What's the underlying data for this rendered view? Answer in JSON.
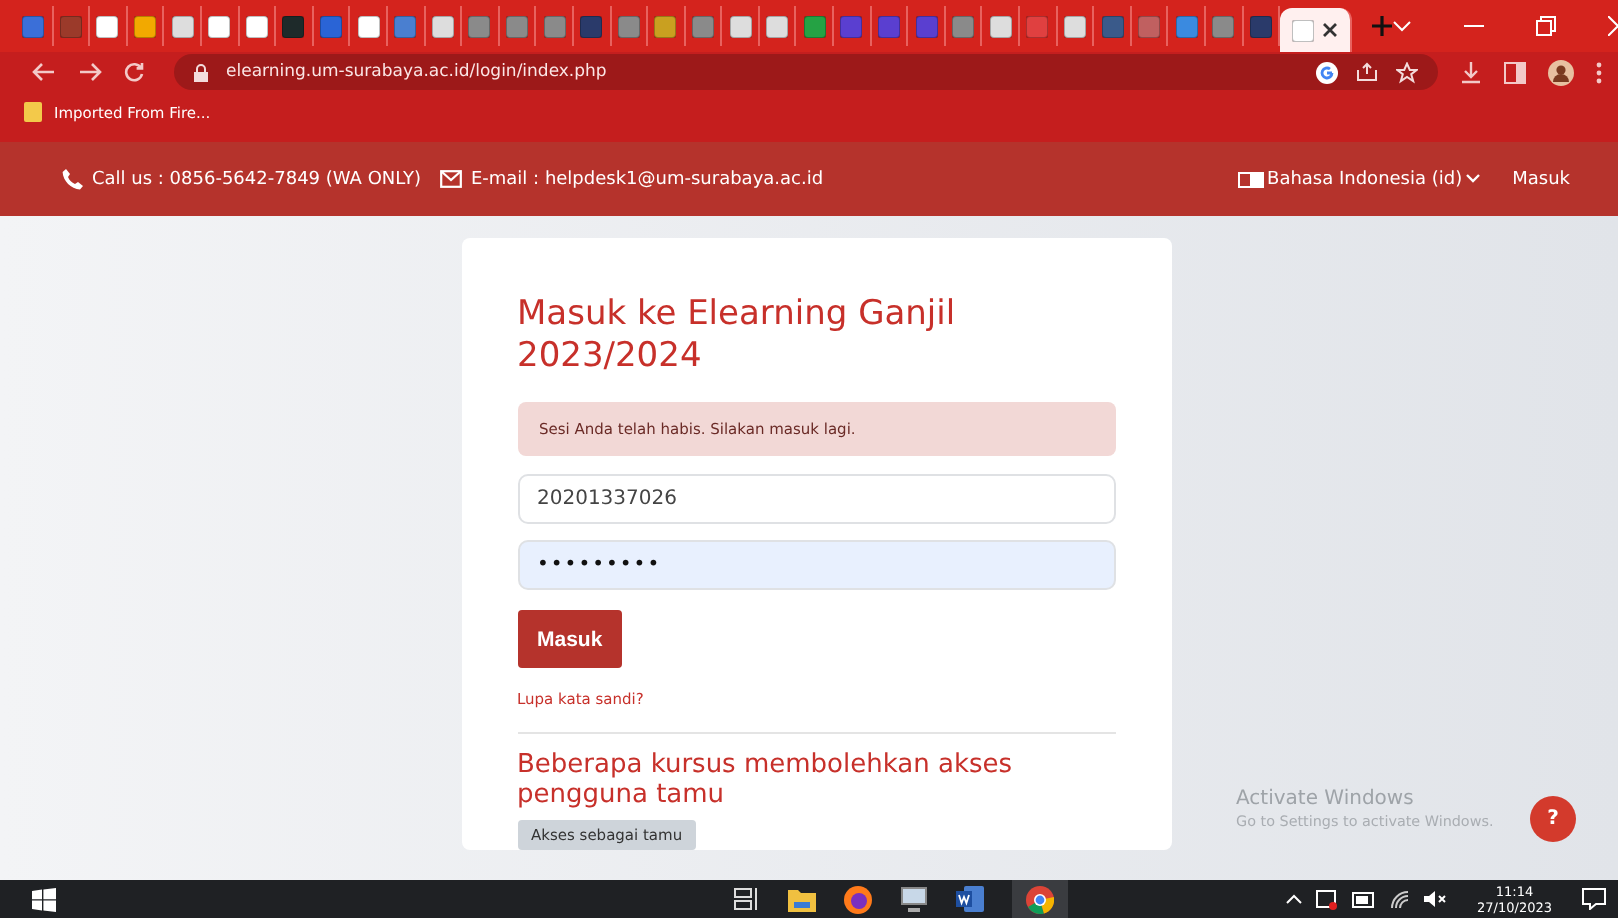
{
  "browser": {
    "tabs": [
      {
        "color": "#3b6fd8",
        "selected": false
      },
      {
        "color": "#9b3a2a",
        "selected": false
      },
      {
        "color": "#ffffff",
        "selected": false
      },
      {
        "color": "#f2a900",
        "selected": false
      },
      {
        "color": "#dddddd",
        "selected": false
      },
      {
        "color": "#ffffff",
        "selected": false
      },
      {
        "color": "#ffffff",
        "selected": false
      },
      {
        "color": "#1e2a2a",
        "selected": false
      },
      {
        "color": "#2a64d6",
        "selected": false
      },
      {
        "color": "#ffffff",
        "selected": false
      },
      {
        "color": "#4a7fd0",
        "selected": false
      },
      {
        "color": "#dddddd",
        "selected": false
      },
      {
        "color": "#8a8a8a",
        "selected": false
      },
      {
        "color": "#8a8a8a",
        "selected": false
      },
      {
        "color": "#8a8a8a",
        "selected": false
      },
      {
        "color": "#2a3a6a",
        "selected": false
      },
      {
        "color": "#8a8a8a",
        "selected": false
      },
      {
        "color": "#c9a020",
        "selected": false
      },
      {
        "color": "#8a8a8a",
        "selected": false
      },
      {
        "color": "#dddddd",
        "selected": false
      },
      {
        "color": "#dddddd",
        "selected": false
      },
      {
        "color": "#25a244",
        "selected": false
      },
      {
        "color": "#5a3fd0",
        "selected": false
      },
      {
        "color": "#5a3fd0",
        "selected": false
      },
      {
        "color": "#5a3fd0",
        "selected": false
      },
      {
        "color": "#8a8a8a",
        "selected": false
      },
      {
        "color": "#dddddd",
        "selected": false
      },
      {
        "color": "#e04040",
        "selected": false
      },
      {
        "color": "#dddddd",
        "selected": false
      },
      {
        "color": "#3a5a8a",
        "selected": false
      },
      {
        "color": "#c06060",
        "selected": false
      },
      {
        "color": "#3a8ae0",
        "selected": false
      },
      {
        "color": "#8a8a8a",
        "selected": false
      },
      {
        "color": "#2a3a6a",
        "selected": false
      },
      {
        "color": "#ffffff",
        "selected": true
      }
    ],
    "url": "elearning.um-surabaya.ac.id/login/index.php",
    "bookmarks": [
      "Imported From Fire..."
    ]
  },
  "site_header": {
    "phone": "Call us : 0856-5642-7849 (WA ONLY)",
    "email": "E-mail : helpdesk1@um-surabaya.ac.id",
    "language": "Bahasa Indonesia (id)",
    "login_link": "Masuk"
  },
  "login_card": {
    "title": "Masuk ke Elearning Ganjil 2023/2024",
    "alert": "Sesi Anda telah habis. Silakan masuk lagi.",
    "username": "20201337026",
    "password": "•••••••••",
    "submit": "Masuk",
    "forgot": "Lupa kata sandi?",
    "guest_heading": "Beberapa kursus membolehkan akses pengguna tamu",
    "guest_button": "Akses sebagai tamu"
  },
  "activation_notice": {
    "title": "Activate Windows",
    "body": "Go to Settings to activate Windows."
  },
  "help_button": "?",
  "taskbar": {
    "time": "11:14",
    "date": "27/10/2023"
  }
}
